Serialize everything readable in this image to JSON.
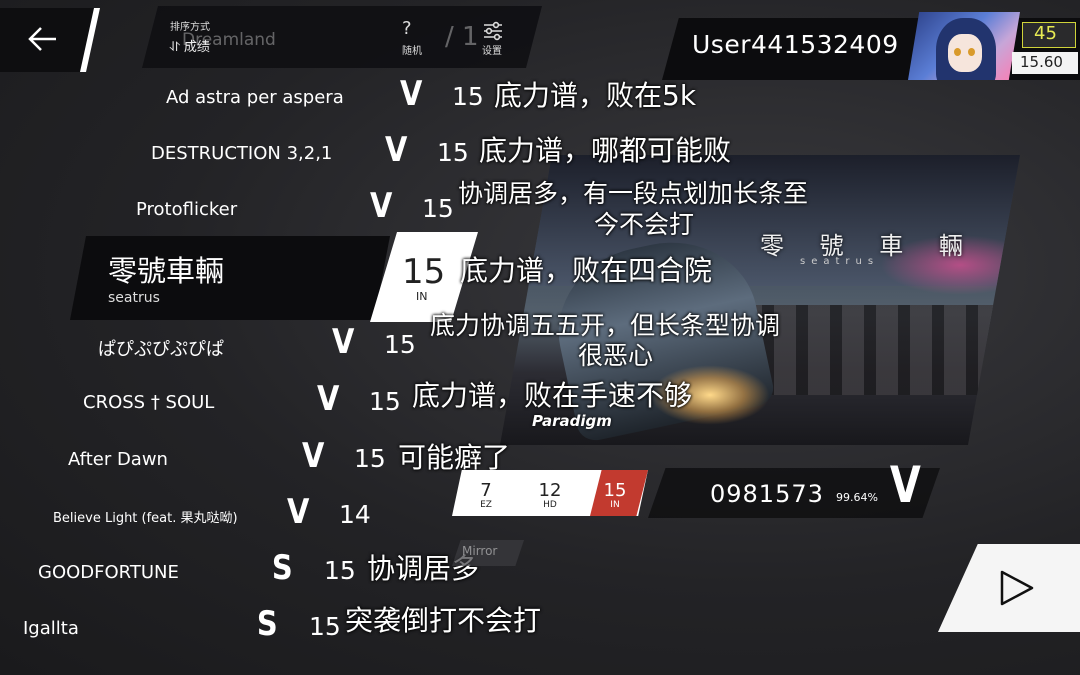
{
  "header": {
    "sort_label": "排序方式",
    "sort_value": "⥯ 成绩",
    "ghost_title": "Dreamland",
    "random_label": "随机",
    "random_icon": "?",
    "ghost_sep": "/ 1",
    "settings_label": "设置"
  },
  "user": {
    "name": "User441532409",
    "level": "45",
    "rks": "15.60"
  },
  "songs": [
    {
      "title": "Ad astra per aspera",
      "grade": "V",
      "level": "15",
      "note": "底力谱，败在5k"
    },
    {
      "title": "DESTRUCTION 3,2,1",
      "grade": "V",
      "level": "15",
      "note": "底力谱，哪都可能败"
    },
    {
      "title": "Protoflicker",
      "grade": "V",
      "level": "15",
      "note": "协调居多，有一段点划加长条至",
      "note2": "今不会打"
    },
    {
      "title": "ぱぴぷぴぷぴぱ",
      "grade": "V",
      "level": "15",
      "note": "底力协调五五开，但长条型协调",
      "note2": "很恶心"
    },
    {
      "title": "CROSS † SOUL",
      "grade": "V",
      "level": "15",
      "note": "底力谱，败在手速不够"
    },
    {
      "title": "After Dawn",
      "grade": "V",
      "level": "15",
      "note": "可能癖了"
    },
    {
      "title": "Believe Light (feat. 果丸哒呦)",
      "grade": "V",
      "level": "14",
      "note": ""
    },
    {
      "title": "GOODFORTUNE",
      "grade": "S",
      "level": "15",
      "note": "协调居多"
    },
    {
      "title": "Igallta",
      "grade": "S",
      "level": "15",
      "note": "突袭倒打不会打"
    }
  ],
  "selected": {
    "title": "零號車輛",
    "artist": "seatrus",
    "level": "15",
    "difficulty": "IN",
    "note": "底力谱，败在四合院",
    "art_title": "零 號 車 輛",
    "art_sub": "seatrus",
    "chapter": "Paradigm"
  },
  "difficulties": [
    {
      "level": "7",
      "label": "EZ"
    },
    {
      "level": "12",
      "label": "HD"
    },
    {
      "level": "15",
      "label": "IN"
    }
  ],
  "score": {
    "value": "0981573",
    "accuracy": "99.64%",
    "grade": "V"
  },
  "mirror_label": "Mirror",
  "colors": {
    "in_red": "#c23a2f",
    "rks_yellow": "#e7ea53"
  }
}
